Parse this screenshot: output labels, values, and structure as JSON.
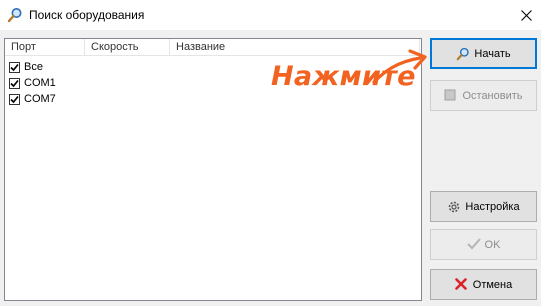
{
  "window": {
    "title": "Поиск оборудования",
    "icons": {
      "title": "magnifier-icon",
      "close": "close-icon"
    }
  },
  "list": {
    "columns": [
      "Порт",
      "Скорость",
      "Название"
    ],
    "rows": [
      {
        "port": "Все",
        "checked": true
      },
      {
        "port": "COM1",
        "checked": true
      },
      {
        "port": "COM7",
        "checked": true
      }
    ]
  },
  "buttons": {
    "start": "Начать",
    "stop": "Остановить",
    "settings": "Настройка",
    "ok": "OK",
    "cancel": "Отмена"
  },
  "annotation": {
    "text": "Нажмите",
    "color": "#f26322"
  }
}
